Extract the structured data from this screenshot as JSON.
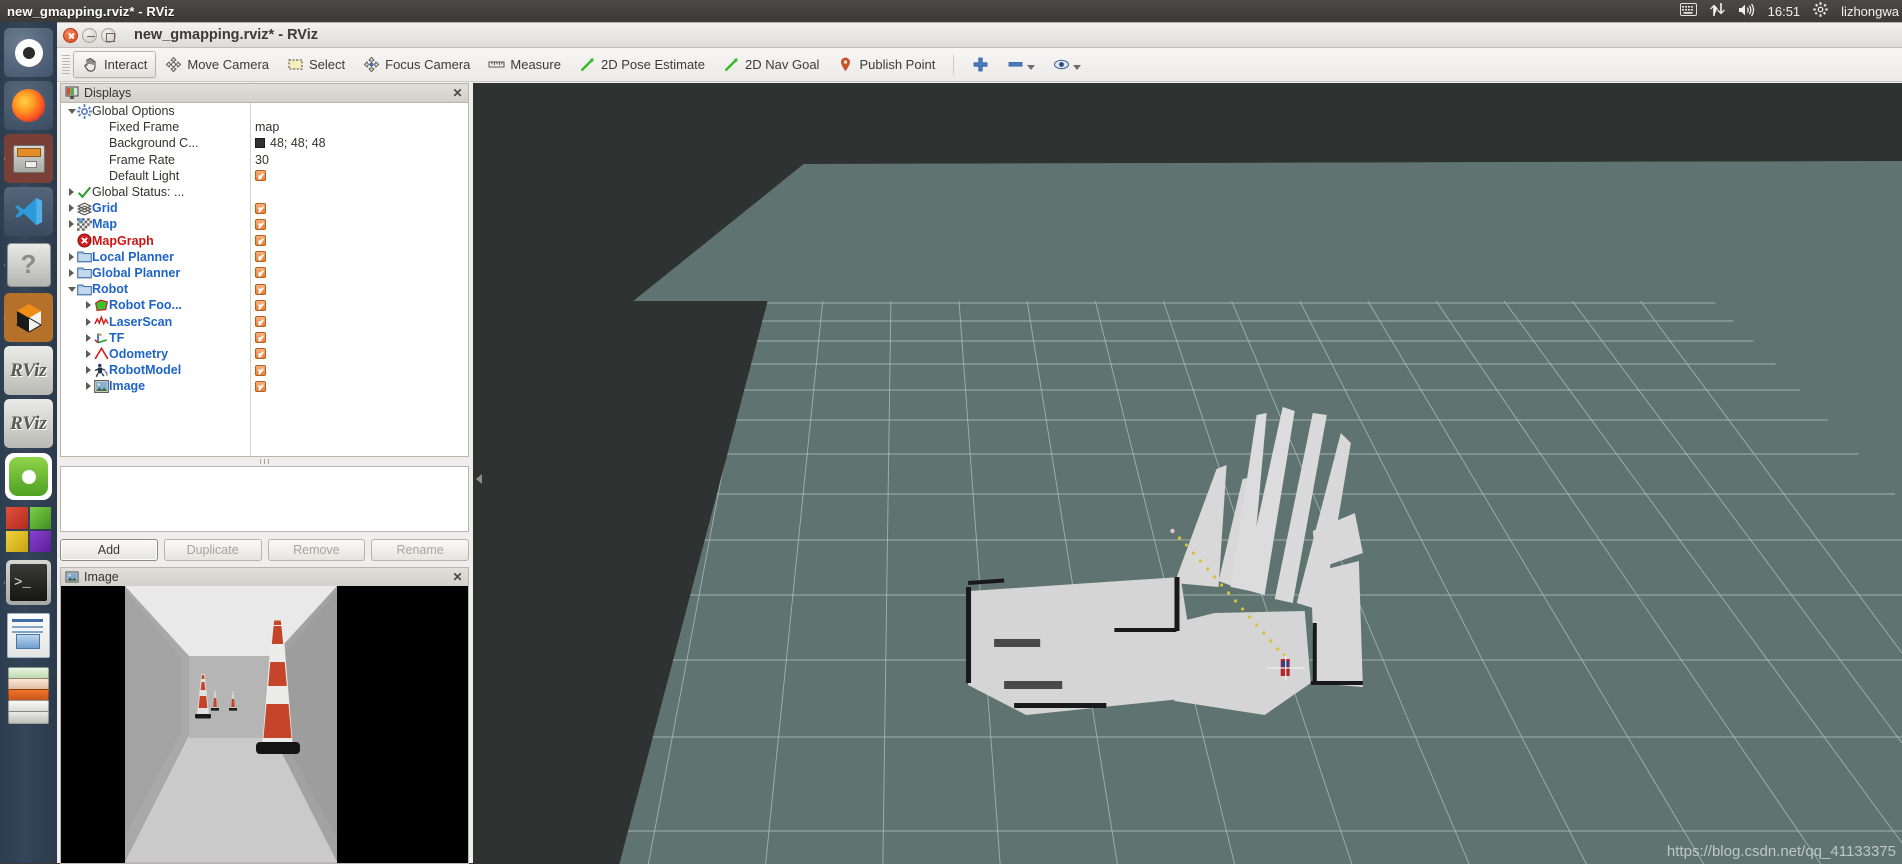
{
  "desktop": {
    "panel_title": "new_gmapping.rviz* - RViz",
    "tray": {
      "keyboard_icon": "keyboard-icon",
      "network_icon": "network-updown-icon",
      "volume_icon": "volume-icon",
      "clock": "16:51",
      "gear_icon": "gear-icon",
      "user": "lizhongwa"
    }
  },
  "launcher": {
    "items": [
      {
        "name": "ubuntu-dash",
        "icon": "ubuntu-logo-icon",
        "running": false
      },
      {
        "name": "firefox",
        "icon": "firefox-icon",
        "running": false
      },
      {
        "name": "files",
        "icon": "file-cabinet-icon",
        "running": true
      },
      {
        "name": "vscode",
        "icon": "visual-studio-code-icon",
        "running": false
      },
      {
        "name": "help",
        "icon": "question-mark-icon",
        "running": true
      },
      {
        "name": "gazebo",
        "icon": "gazebo-cube-icon",
        "running": true
      },
      {
        "name": "rviz-1",
        "icon": "rviz-icon",
        "running": true
      },
      {
        "name": "rviz-2",
        "icon": "rviz-icon",
        "running": true,
        "focused": true
      },
      {
        "name": "green-app",
        "icon": "green-robot-icon",
        "running": false
      },
      {
        "name": "workspace-switcher",
        "icon": "colored-cubes-icon",
        "running": false
      },
      {
        "name": "terminal",
        "icon": "terminal-icon",
        "running": true
      },
      {
        "name": "libreoffice-impress",
        "icon": "document-image-icon",
        "running": false
      },
      {
        "name": "app-stack",
        "icon": "stacked-apps-icon",
        "running": false
      }
    ]
  },
  "window": {
    "title": "new_gmapping.rviz* - RViz",
    "controls": {
      "close": "close-icon",
      "minimize": "minimize-icon",
      "maximize": "maximize-icon"
    }
  },
  "toolbar": {
    "buttons": [
      {
        "label": "Interact",
        "icon": "hand-cursor-icon",
        "active": true
      },
      {
        "label": "Move Camera",
        "icon": "move-camera-icon",
        "active": false
      },
      {
        "label": "Select",
        "icon": "selection-box-icon",
        "active": false
      },
      {
        "label": "Focus Camera",
        "icon": "focus-camera-icon",
        "active": false
      },
      {
        "label": "Measure",
        "icon": "ruler-icon",
        "active": false
      },
      {
        "label": "2D Pose Estimate",
        "icon": "green-arrow-icon",
        "active": false
      },
      {
        "label": "2D Nav Goal",
        "icon": "green-arrow-icon",
        "active": false
      },
      {
        "label": "Publish Point",
        "icon": "map-pin-icon",
        "active": false
      }
    ],
    "extra": [
      {
        "name": "add-view-button",
        "icon": "plus-icon"
      },
      {
        "name": "remove-view-button",
        "icon": "minus-dropdown-icon"
      },
      {
        "name": "visibility-button",
        "icon": "eye-dropdown-icon"
      }
    ]
  },
  "displays": {
    "title": "Displays",
    "title_icon": "displays-panel-icon",
    "close_icon": "close-icon",
    "tree": [
      {
        "indent": 0,
        "arrow": "down",
        "icon": "gear-icon",
        "label": "Global Options",
        "style": "plain",
        "value_type": "none"
      },
      {
        "indent": 1,
        "arrow": "none",
        "icon": "none",
        "label": "Fixed Frame",
        "style": "plain",
        "value_type": "text",
        "value": "map"
      },
      {
        "indent": 1,
        "arrow": "none",
        "icon": "none",
        "label": "Background C...",
        "style": "plain",
        "value_type": "color",
        "value": "48; 48; 48",
        "color": "#303030"
      },
      {
        "indent": 1,
        "arrow": "none",
        "icon": "none",
        "label": "Frame Rate",
        "style": "plain",
        "value_type": "text",
        "value": "30"
      },
      {
        "indent": 1,
        "arrow": "none",
        "icon": "none",
        "label": "Default Light",
        "style": "plain",
        "value_type": "check"
      },
      {
        "indent": 0,
        "arrow": "right",
        "icon": "green-check-icon",
        "label": "Global Status: ...",
        "style": "plain",
        "value_type": "none"
      },
      {
        "indent": 0,
        "arrow": "right",
        "icon": "grid-icon",
        "label": "Grid",
        "style": "link",
        "value_type": "check"
      },
      {
        "indent": 0,
        "arrow": "right",
        "icon": "map-icon",
        "label": "Map",
        "style": "link",
        "value_type": "check"
      },
      {
        "indent": 0,
        "arrow": "none",
        "icon": "error-icon",
        "label": "MapGraph",
        "style": "err",
        "value_type": "check"
      },
      {
        "indent": 0,
        "arrow": "right",
        "icon": "folder-icon",
        "label": "Local Planner",
        "style": "link",
        "value_type": "check"
      },
      {
        "indent": 0,
        "arrow": "right",
        "icon": "folder-icon",
        "label": "Global Planner",
        "style": "link",
        "value_type": "check"
      },
      {
        "indent": 0,
        "arrow": "down",
        "icon": "folder-icon",
        "label": "Robot",
        "style": "link",
        "value_type": "check"
      },
      {
        "indent": 1,
        "arrow": "right",
        "icon": "polygon-icon",
        "label": "Robot Foo...",
        "style": "link",
        "value_type": "check"
      },
      {
        "indent": 1,
        "arrow": "right",
        "icon": "laserscan-icon",
        "label": "LaserScan",
        "style": "link",
        "value_type": "check"
      },
      {
        "indent": 1,
        "arrow": "right",
        "icon": "tf-axes-icon",
        "label": "TF",
        "style": "link",
        "value_type": "check"
      },
      {
        "indent": 1,
        "arrow": "right",
        "icon": "odometry-icon",
        "label": "Odometry",
        "style": "link",
        "value_type": "check"
      },
      {
        "indent": 1,
        "arrow": "right",
        "icon": "robotmodel-icon",
        "label": "RobotModel",
        "style": "link",
        "value_type": "check"
      },
      {
        "indent": 1,
        "arrow": "right",
        "icon": "image-icon",
        "label": "Image",
        "style": "link",
        "value_type": "check"
      }
    ],
    "buttons": [
      {
        "label": "Add",
        "enabled": true
      },
      {
        "label": "Duplicate",
        "enabled": false
      },
      {
        "label": "Remove",
        "enabled": false
      },
      {
        "label": "Rename",
        "enabled": false
      }
    ]
  },
  "image_panel": {
    "title": "Image",
    "title_icon": "image-panel-icon",
    "close_icon": "close-icon",
    "scene": "corridor with orange traffic cones"
  },
  "viewport": {
    "background_color": "#2e3231",
    "floor_color": "#5f7471",
    "grid_color": "#c8d2d0",
    "map_occupied_color": "#d3d3d3",
    "map_wall_color": "#1a1a1a",
    "path_color": "#d6c23a",
    "robot_marker_color": "#b3282d",
    "collapse_icon": "collapse-left-icon",
    "watermark": "https://blog.csdn.net/qq_41133375"
  }
}
